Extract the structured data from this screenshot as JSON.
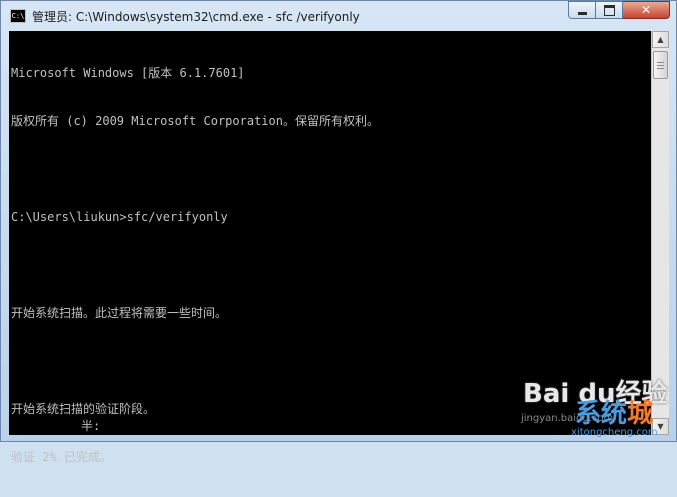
{
  "window": {
    "title": "管理员: C:\\Windows\\system32\\cmd.exe - sfc  /verifyonly",
    "icon_text": "C:\\",
    "controls": {
      "minimize": "minimize-icon",
      "maximize": "maximize-icon",
      "close": "close-icon"
    },
    "close_glyph": "✕"
  },
  "console": {
    "lines": [
      "Microsoft Windows [版本 6.1.7601]",
      "版权所有 (c) 2009 Microsoft Corporation。保留所有权利。",
      "",
      "C:\\Users\\liukun>sfc/verifyonly",
      "",
      "开始系统扫描。此过程将需要一些时间。",
      "",
      "开始系统扫描的验证阶段。",
      "验证 2% 已完成。"
    ],
    "ime_indicator": "半:"
  },
  "scrollbar": {
    "up_glyph": "▲",
    "down_glyph": "▼"
  },
  "watermark": {
    "baidu_logo": "Bai du经验",
    "baidu_url": "jingyan.baidu.com",
    "brand_text": "系统",
    "brand_accent": "城",
    "brand_url": "xitongcheng.com"
  },
  "colors": {
    "console_bg": "#000000",
    "console_fg": "#c0c0c0",
    "close_button": "#c7452f"
  }
}
